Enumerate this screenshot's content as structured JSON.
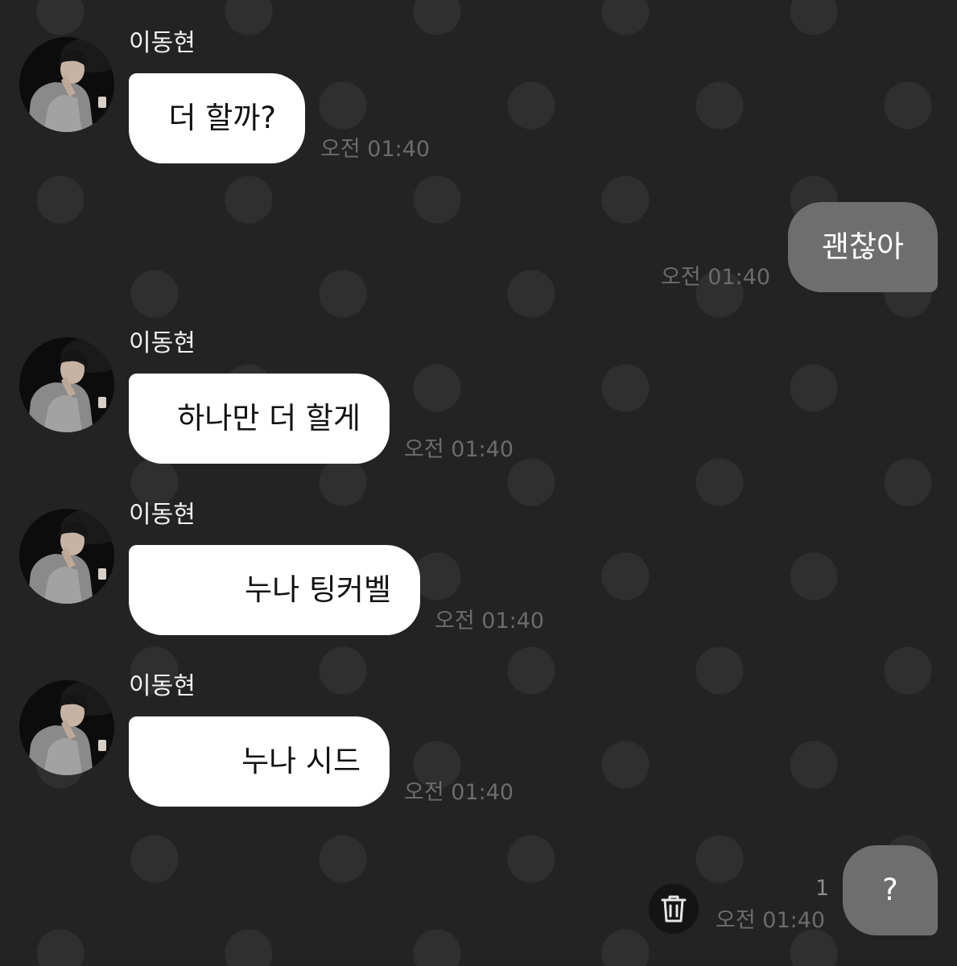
{
  "sender_name": "이동현",
  "messages": [
    {
      "text": "더 할까?",
      "time": "오전 01:40"
    },
    {
      "text": "괜찮아",
      "time": "오전 01:40"
    },
    {
      "text": "하나만 더 할게",
      "time": "오전 01:40"
    },
    {
      "text": "누나 팅커벨",
      "time": "오전 01:40"
    },
    {
      "text": "누나 시드",
      "time": "오전 01:40"
    },
    {
      "text": "?",
      "time": "오전 01:40",
      "unread_count": "1"
    }
  ],
  "icons": {
    "avatar": "profile-photo",
    "delete": "trash-icon"
  },
  "colors": {
    "background": "#232323",
    "pattern_dot": "#2f2f2f",
    "incoming_bubble": "#ffffff",
    "outgoing_bubble": "#6e6e6e",
    "timestamp": "#6c6c6c"
  }
}
